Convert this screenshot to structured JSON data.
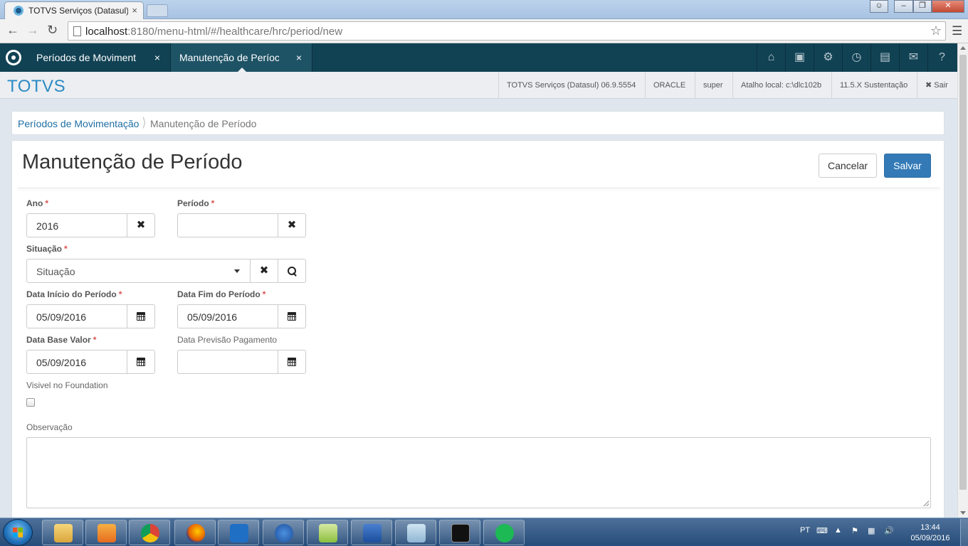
{
  "browser": {
    "tab_title": "TOTVS Serviços (Datasul)",
    "tab_close": "×",
    "url_host": "localhost",
    "url_path": ":8180/menu-html/#/healthcare/hrc/period/new"
  },
  "app_tabs": [
    {
      "label": "Períodos de Moviment",
      "close": "×"
    },
    {
      "label": "Manutenção de Períoc",
      "close": "×"
    }
  ],
  "nav_icons": [
    "home-icon",
    "sitemap-icon",
    "gear-icon",
    "dashboard-icon",
    "document-icon",
    "mail-icon",
    "help-icon"
  ],
  "infobar": {
    "brand": "TOTVS",
    "product": "TOTVS Serviços (Datasul) 06.9.5554",
    "database": "ORACLE",
    "user": "super",
    "shortcut": "Atalho local: c:\\dlc102b",
    "version": "11.5.X Sustentação",
    "logout": "Sair"
  },
  "breadcrumb": {
    "parent": "Períodos de Movimentação",
    "current": "Manutenção de Período"
  },
  "page": {
    "title": "Manutenção de Período",
    "cancel_label": "Cancelar",
    "save_label": "Salvar"
  },
  "form": {
    "required_mark": "*",
    "ano": {
      "label": "Ano",
      "value": "2016"
    },
    "periodo": {
      "label": "Período",
      "value": ""
    },
    "situacao": {
      "label": "Situação",
      "value": "Situação"
    },
    "data_inicio": {
      "label": "Data Início do Período",
      "value": "05/09/2016"
    },
    "data_fim": {
      "label": "Data Fim do Período",
      "value": "05/09/2016"
    },
    "data_base": {
      "label": "Data Base Valor",
      "value": "05/09/2016"
    },
    "data_previsao": {
      "label": "Data Previsão Pagamento",
      "value": ""
    },
    "visivel": {
      "label": "Visivel no Foundation",
      "checked": false
    },
    "observacao": {
      "label": "Observação",
      "value": ""
    }
  },
  "taskbar": {
    "language": "PT",
    "time": "13:44",
    "date": "05/09/2016",
    "apps": [
      "file-explorer-icon",
      "media-player-icon",
      "chrome-icon",
      "firefox-icon",
      "lync-icon",
      "help-icon",
      "notepad-plus-icon",
      "word-icon",
      "folder-icon",
      "cmd-icon",
      "spotify-icon"
    ]
  },
  "colors": {
    "nav_bg": "#114254",
    "brand": "#2c8bc4",
    "primary_button": "#337ab7",
    "required": "#d9534f"
  }
}
